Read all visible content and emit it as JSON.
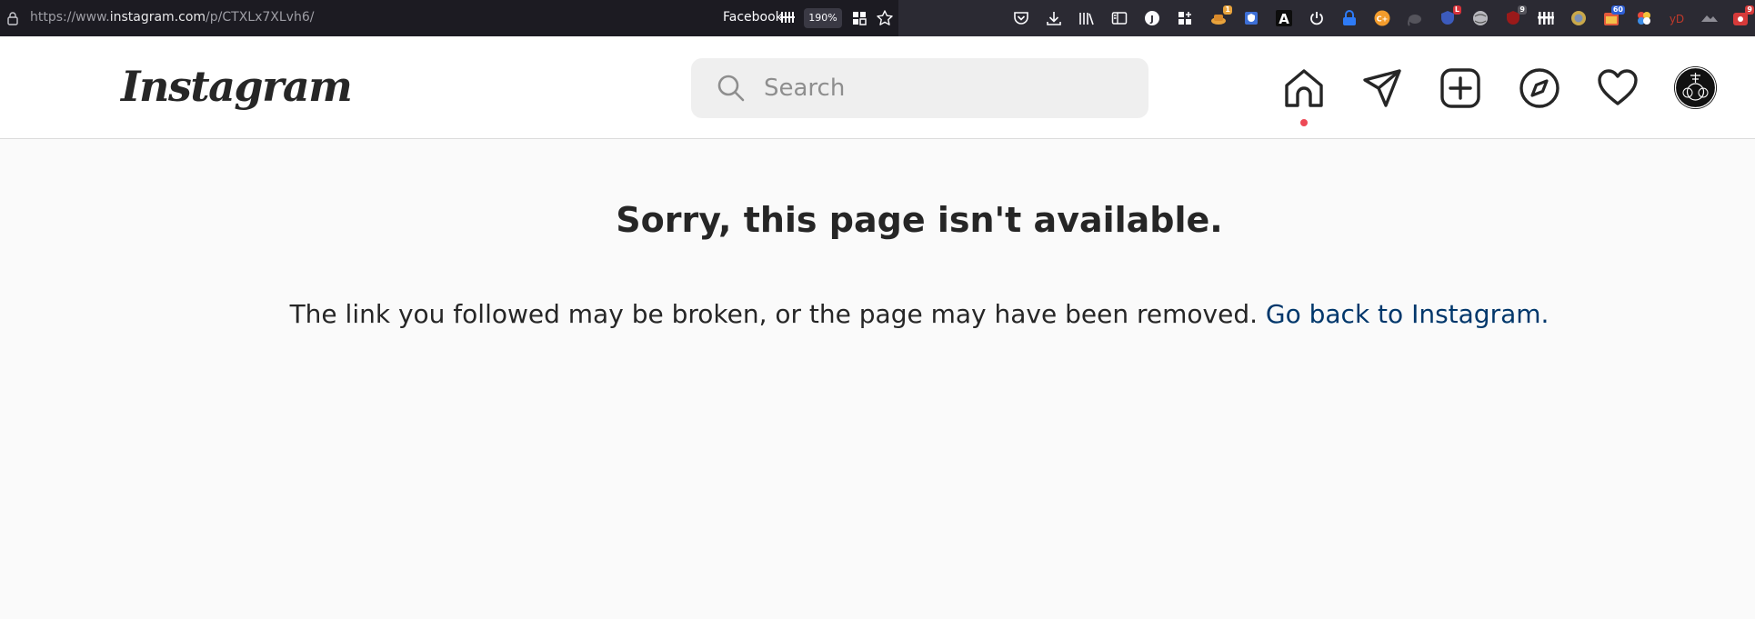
{
  "browser": {
    "url_prefix": "https://www.",
    "url_host": "instagram.com",
    "url_path": "/p/CTXLx7XLvh6/",
    "site_chip": "Facebook",
    "zoom": "190%",
    "extension_badges": [
      "1",
      "L",
      "9",
      "60",
      "9"
    ],
    "extension_text_a": "A",
    "extension_text_yd": "yD",
    "extension_text_c": "C+"
  },
  "header": {
    "logo": "Instagram",
    "search_placeholder": "Search"
  },
  "icons": {
    "home": "home-icon",
    "messages": "direct-message-icon",
    "new_post": "new-post-icon",
    "explore": "explore-compass-icon",
    "activity": "heart-icon",
    "profile": "profile-avatar"
  },
  "error": {
    "title": "Sorry, this page isn't available.",
    "message": "The link you followed may be broken, or the page may have been removed. ",
    "link_label": "Go back to Instagram."
  },
  "colors": {
    "link": "#00376b",
    "notification_dot": "#ed4956",
    "browser_bar": "#2b2a33"
  }
}
